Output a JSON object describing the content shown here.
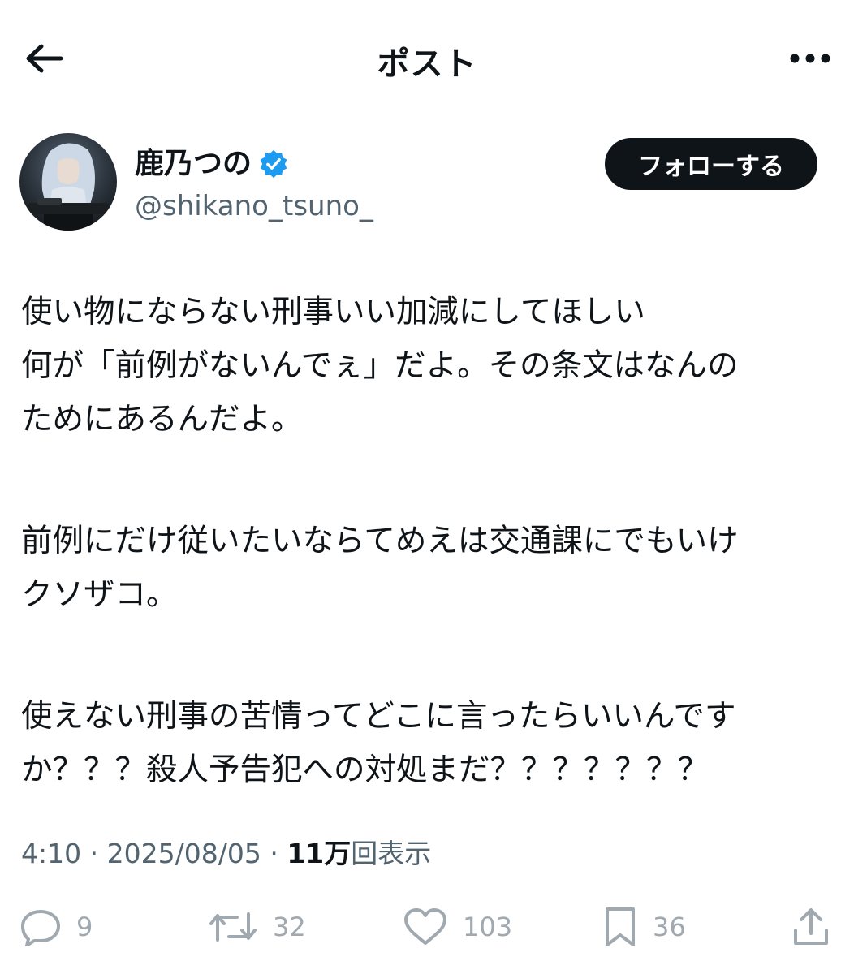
{
  "header": {
    "title": "ポスト"
  },
  "author": {
    "display_name": "鹿乃つの",
    "handle": "@shikano_tsuno_",
    "verified": true,
    "follow_label": "フォローする"
  },
  "post": {
    "lines": [
      "使い物にならない刑事いい加減にしてほしい",
      "何が「前例がないんでぇ」だよ。その条文はなんの",
      "ためにあるんだよ。",
      "前例にだけ従いたいならてめえは交通課にでもいけ",
      "クソザコ。",
      "使えない刑事の苦情ってどこに言ったらいいんです",
      "か？？？殺人予告犯への対処まだ？？？？？？？"
    ]
  },
  "meta": {
    "time": "4:10",
    "sep1": "·",
    "date": "2025/08/05",
    "sep2": "·",
    "views_count": "11万",
    "views_label": "回表示"
  },
  "actions": {
    "replies": "9",
    "reposts": "32",
    "likes": "103",
    "bookmarks": "36"
  },
  "colors": {
    "text": "#0f1419",
    "muted": "#536471",
    "verified": "#1d9bf0",
    "follow_bg": "#0f1419"
  }
}
